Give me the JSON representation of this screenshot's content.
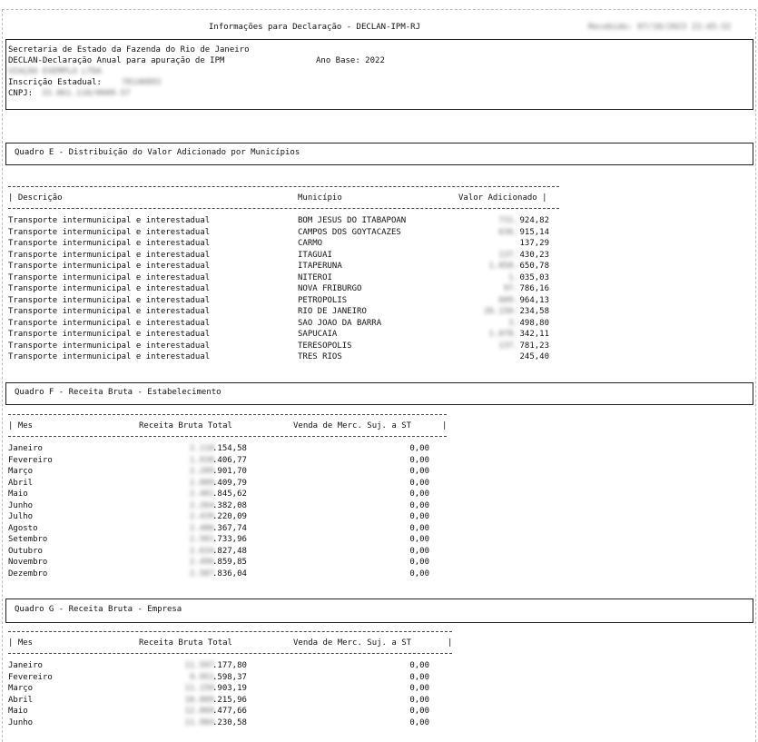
{
  "report_title": "Informações para Declaração - DECLAN-IPM-RJ",
  "timestamp": "Recebido: 07/10/2023 22:45:32",
  "header": {
    "line1": "Secretaria de Estado da Fazenda do Rio de Janeiro",
    "line2": "DECLAN-Declaração Anual para apuração de IPM",
    "ano_base": "Ano Base: 2022",
    "company_name": "VIAÇÃO EXEMPLO LTDA",
    "ie_label": "Inscrição Estadual:",
    "ie_value": "78140893",
    "cnpj_label": "CNPJ:",
    "cnpj_value": "33.061.110/0009-57"
  },
  "quadro_e": {
    "title": "Quadro E - Distribuição do Valor Adicionado por Municípios",
    "headers": [
      "| Descrição",
      "Município",
      "Valor Adicionado |"
    ],
    "rows": [
      {
        "desc": "Transporte intermunicipal e interestadual",
        "mun": "BOM JESUS DO ITABAPOAN",
        "vh": "731.",
        "vv": "924,82"
      },
      {
        "desc": "Transporte intermunicipal e interestadual",
        "mun": "CAMPOS DOS GOYTACAZES",
        "vh": "636.",
        "vv": "915,14"
      },
      {
        "desc": "Transporte intermunicipal e interestadual",
        "mun": "CARMO",
        "vh": "",
        "vv": "137,29"
      },
      {
        "desc": "Transporte intermunicipal e interestadual",
        "mun": "ITAGUAI",
        "vh": "137.",
        "vv": "430,23"
      },
      {
        "desc": "Transporte intermunicipal e interestadual",
        "mun": "ITAPERUNA",
        "vh": "1.058.",
        "vv": "650,78"
      },
      {
        "desc": "Transporte intermunicipal e interestadual",
        "mun": "NITEROI",
        "vh": "1.",
        "vv": "035,03"
      },
      {
        "desc": "Transporte intermunicipal e interestadual",
        "mun": "NOVA FRIBURGO",
        "vh": "97.",
        "vv": "786,16"
      },
      {
        "desc": "Transporte intermunicipal e interestadual",
        "mun": "PETROPOLIS",
        "vh": "609.",
        "vv": "964,13"
      },
      {
        "desc": "Transporte intermunicipal e interestadual",
        "mun": "RIO DE JANEIRO",
        "vh": "26.150.",
        "vv": "234,58"
      },
      {
        "desc": "Transporte intermunicipal e interestadual",
        "mun": "SAO JOAO DA BARRA",
        "vh": "3.",
        "vv": "498,80"
      },
      {
        "desc": "Transporte intermunicipal e interestadual",
        "mun": "SAPUCAIA",
        "vh": "1.078.",
        "vv": "342,11"
      },
      {
        "desc": "Transporte intermunicipal e interestadual",
        "mun": "TERESOPOLIS",
        "vh": "137.",
        "vv": "781,23"
      },
      {
        "desc": "Transporte intermunicipal e interestadual",
        "mun": "TRES RIOS",
        "vh": "",
        "vv": "245,40"
      }
    ]
  },
  "quadro_f": {
    "title": "Quadro F - Receita Bruta - Estabelecimento",
    "headers": [
      "| Mes",
      "Receita Bruta Total",
      "Venda de Merc. Suj. a ST",
      "|"
    ],
    "rows": [
      {
        "mes": "Janeiro",
        "rh": "2.118",
        "rv": ".154,58",
        "st": "0,00"
      },
      {
        "mes": "Fevereiro",
        "rh": "1.938",
        "rv": ".406,77",
        "st": "0,00"
      },
      {
        "mes": "Março",
        "rh": "2.209",
        "rv": ".901,70",
        "st": "0,00"
      },
      {
        "mes": "Abril",
        "rh": "2.089",
        "rv": ".409,79",
        "st": "0,00"
      },
      {
        "mes": "Maio",
        "rh": "2.401",
        "rv": ".845,62",
        "st": "0,00"
      },
      {
        "mes": "Junho",
        "rh": "2.264",
        "rv": ".382,08",
        "st": "0,00"
      },
      {
        "mes": "Julho",
        "rh": "2.439",
        "rv": ".220,09",
        "st": "0,00"
      },
      {
        "mes": "Agosto",
        "rh": "2.486",
        "rv": ".367,74",
        "st": "0,00"
      },
      {
        "mes": "Setembro",
        "rh": "2.501",
        "rv": ".733,96",
        "st": "0,00"
      },
      {
        "mes": "Outubro",
        "rh": "2.634",
        "rv": ".827,48",
        "st": "0,00"
      },
      {
        "mes": "Novembro",
        "rh": "2.496",
        "rv": ".859,85",
        "st": "0,00"
      },
      {
        "mes": "Dezembro",
        "rh": "2.507",
        "rv": ".836,04",
        "st": "0,00"
      }
    ]
  },
  "quadro_g": {
    "title": "Quadro G - Receita Bruta - Empresa",
    "headers": [
      "| Mes",
      "Receita Bruta Total",
      "Venda de Merc. Suj. a ST",
      "|"
    ],
    "rows": [
      {
        "mes": "Janeiro",
        "rh": "11.597",
        "rv": ".177,80",
        "st": "0,00"
      },
      {
        "mes": "Fevereiro",
        "rh": "9.951",
        "rv": ".598,37",
        "st": "0,00"
      },
      {
        "mes": "Março",
        "rh": "11.150",
        "rv": ".903,19",
        "st": "0,00"
      },
      {
        "mes": "Abril",
        "rh": "10.889",
        "rv": ".215,96",
        "st": "0,00"
      },
      {
        "mes": "Maio",
        "rh": "12.060",
        "rv": ".477,66",
        "st": "0,00"
      },
      {
        "mes": "Junho",
        "rh": "11.984",
        "rv": ".230,58",
        "st": "0,00"
      }
    ]
  }
}
